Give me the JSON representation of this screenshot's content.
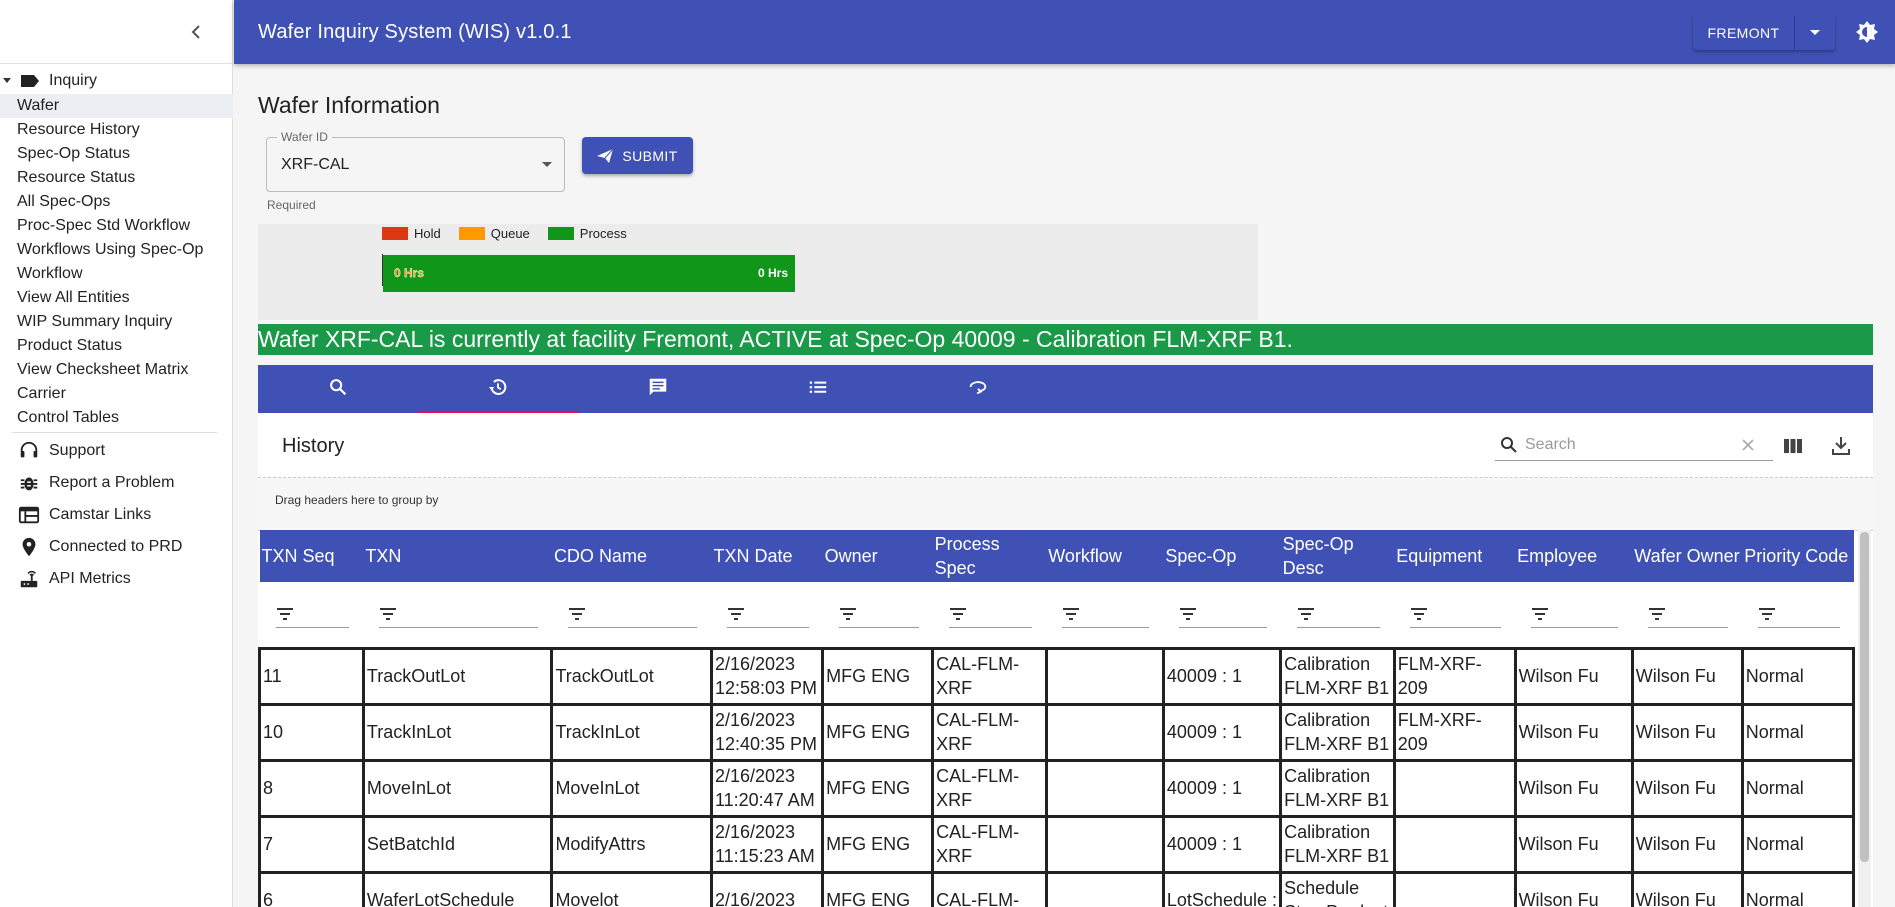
{
  "app": {
    "title": "Wafer Inquiry System (WIS) v1.0.1",
    "facility": "FREMONT"
  },
  "sidebar": {
    "group_label": "Inquiry",
    "items": [
      {
        "label": "Wafer",
        "active": true
      },
      {
        "label": "Resource History"
      },
      {
        "label": "Spec-Op Status"
      },
      {
        "label": "Resource Status"
      },
      {
        "label": "All Spec-Ops"
      },
      {
        "label": "Proc-Spec Std Workflow"
      },
      {
        "label": "Workflows Using Spec-Op"
      },
      {
        "label": "Workflow"
      },
      {
        "label": "View All Entities"
      },
      {
        "label": "WIP Summary Inquiry"
      },
      {
        "label": "Product Status"
      },
      {
        "label": "View Checksheet Matrix"
      },
      {
        "label": "Carrier"
      },
      {
        "label": "Control Tables"
      }
    ],
    "util": [
      {
        "label": "Support",
        "icon": "headset-icon"
      },
      {
        "label": "Report a Problem",
        "icon": "bug-icon"
      },
      {
        "label": "Camstar Links",
        "icon": "web-window-icon"
      },
      {
        "label": "Connected to PRD",
        "icon": "location-pin-icon"
      },
      {
        "label": "API Metrics",
        "icon": "router-icon"
      }
    ]
  },
  "main": {
    "title": "Wafer Information",
    "wafer_field": {
      "label": "Wafer ID",
      "value": "XRF-CAL",
      "helper": "Required"
    },
    "submit_label": "SUBMIT",
    "timeline": {
      "legend": [
        {
          "label": "Hold",
          "color": "#dc3912"
        },
        {
          "label": "Queue",
          "color": "#ff9900"
        },
        {
          "label": "Process",
          "color": "#109618"
        }
      ],
      "bar_start_label": "0 Hrs",
      "bar_end_label": "0 Hrs"
    },
    "status_banner": "Wafer XRF-CAL is currently at facility Fremont, ACTIVE at Spec-Op 40009 - Calibration FLM-XRF B1.",
    "tabs": [
      {
        "icon": "search-icon"
      },
      {
        "icon": "history-icon",
        "active": true
      },
      {
        "icon": "comment-icon"
      },
      {
        "icon": "list-icon"
      },
      {
        "icon": "loop-icon"
      }
    ]
  },
  "history": {
    "title": "History",
    "search_placeholder": "Search",
    "group_hint": "Drag headers here to group by",
    "columns": [
      "TXN Seq",
      "TXN",
      "CDO Name",
      "TXN Date",
      "Owner",
      "Process Spec",
      "Workflow",
      "Spec-Op",
      "Spec-Op Desc",
      "Equipment",
      "Employee",
      "Wafer Owner",
      "Priority Code"
    ],
    "rows": [
      [
        "11",
        "TrackOutLot",
        "TrackOutLot",
        "2/16/2023 12:58:03 PM",
        "MFG ENG",
        "CAL-FLM-XRF",
        "",
        "40009 : 1",
        "Calibration FLM-XRF B1",
        "FLM-XRF-209",
        "Wilson Fu",
        "Wilson Fu",
        "Normal"
      ],
      [
        "10",
        "TrackInLot",
        "TrackInLot",
        "2/16/2023 12:40:35 PM",
        "MFG ENG",
        "CAL-FLM-XRF",
        "",
        "40009 : 1",
        "Calibration FLM-XRF B1",
        "FLM-XRF-209",
        "Wilson Fu",
        "Wilson Fu",
        "Normal"
      ],
      [
        "8",
        "MoveInLot",
        "MoveInLot",
        "2/16/2023 11:20:47 AM",
        "MFG ENG",
        "CAL-FLM-XRF",
        "",
        "40009 : 1",
        "Calibration FLM-XRF B1",
        "",
        "Wilson Fu",
        "Wilson Fu",
        "Normal"
      ],
      [
        "7",
        "SetBatchId",
        "ModifyAttrs",
        "2/16/2023 11:15:23 AM",
        "MFG ENG",
        "CAL-FLM-XRF",
        "",
        "40009 : 1",
        "Calibration FLM-XRF B1",
        "",
        "Wilson Fu",
        "Wilson Fu",
        "Normal"
      ],
      [
        "6",
        "WaferLotSchedule",
        "Movelot",
        "2/16/2023",
        "MFG ENG",
        "CAL-FLM-",
        "",
        "LotSchedule :",
        "Schedule Step Product",
        "",
        "Wilson Fu",
        "Wilson Fu",
        "Normal"
      ]
    ]
  }
}
